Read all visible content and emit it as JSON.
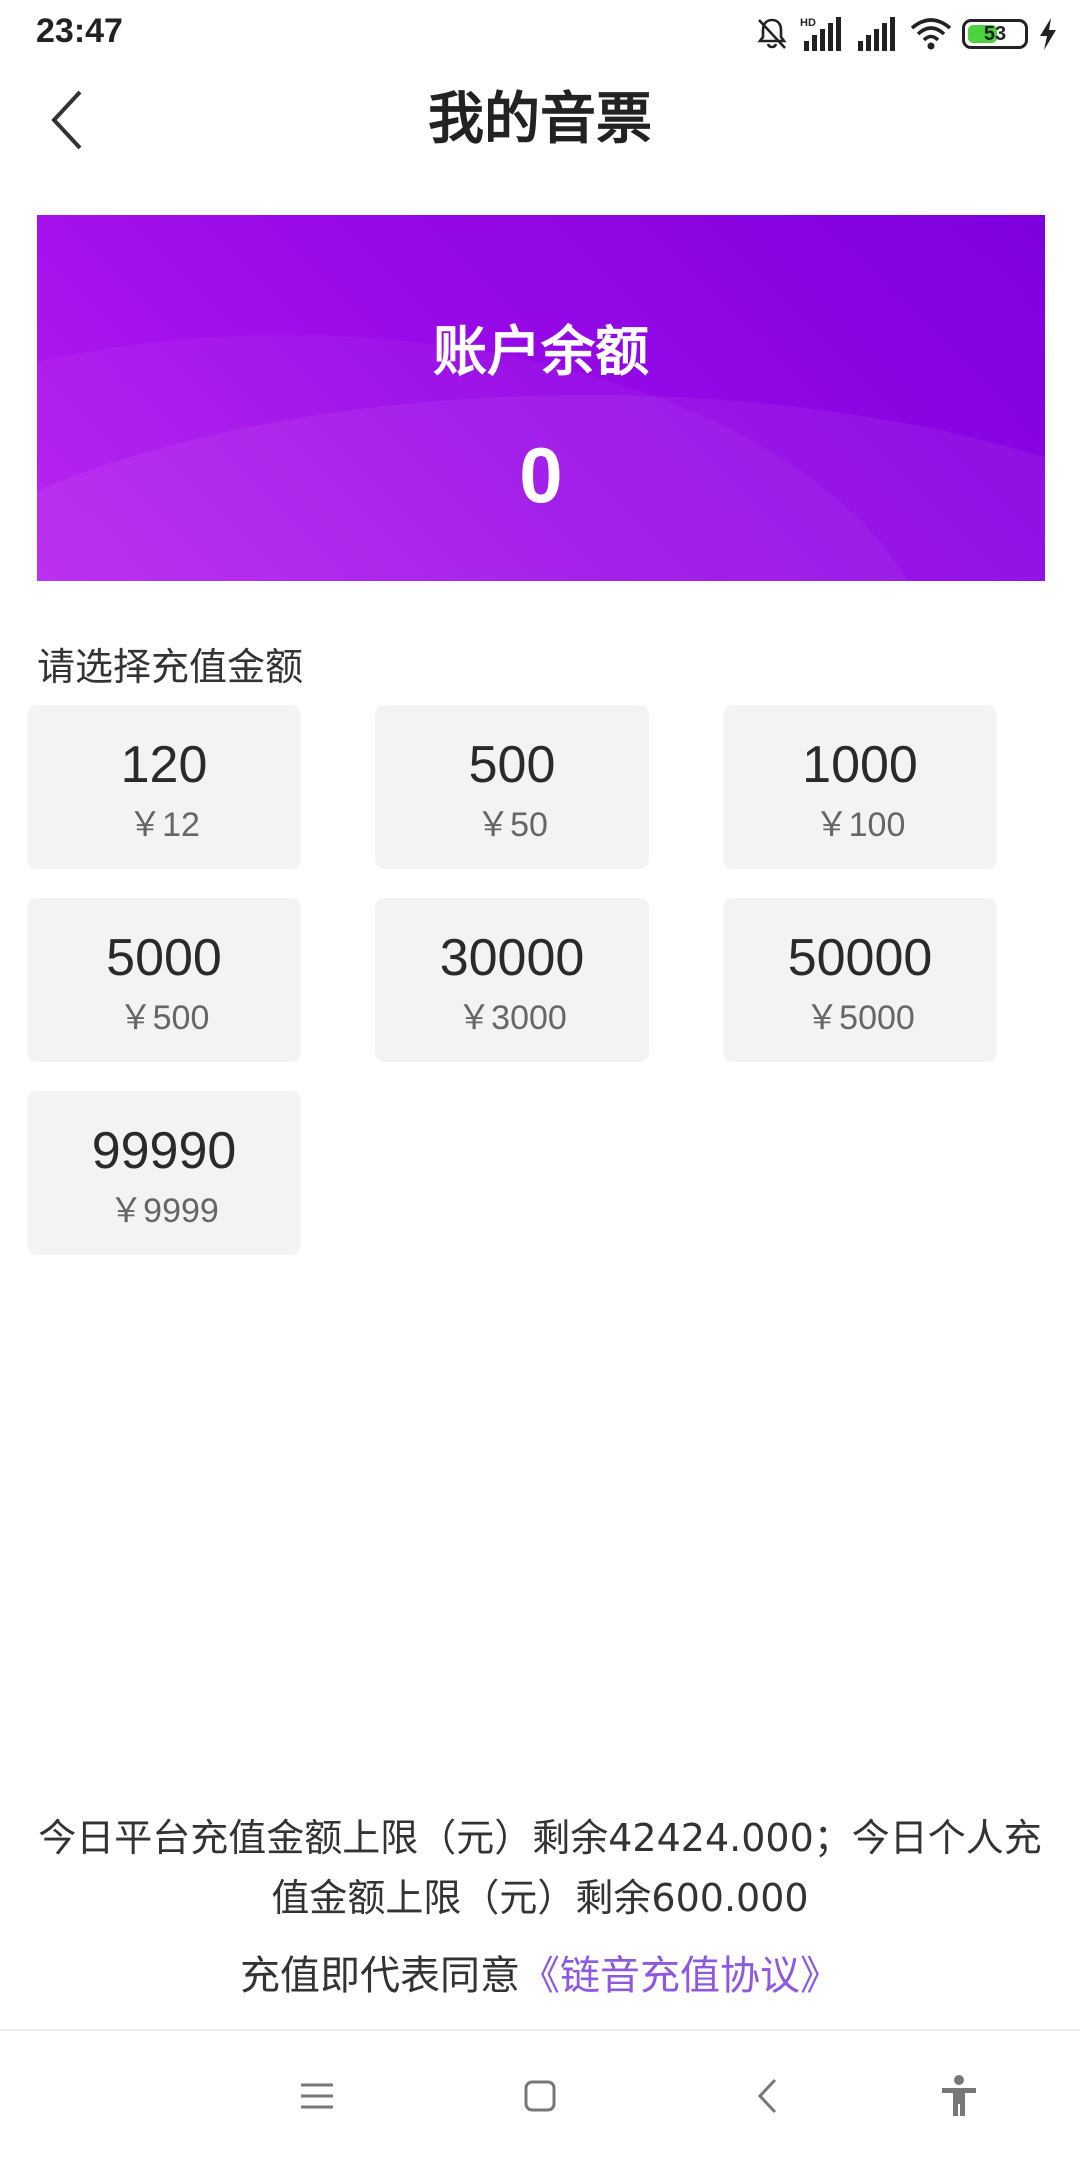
{
  "status_bar": {
    "time": "23:47",
    "battery": "53",
    "battery_level": 0.53,
    "icons": [
      "bell-muted-icon",
      "hd-signal-icon",
      "signal-icon",
      "wifi-icon",
      "battery-icon",
      "charging-icon"
    ]
  },
  "header": {
    "title": "我的音票",
    "back_icon": "chevron-left-icon"
  },
  "balance": {
    "label": "账户余额",
    "value": "0"
  },
  "recharge": {
    "prompt": "请选择充值金额",
    "options": [
      {
        "coins": "120",
        "price": "￥12"
      },
      {
        "coins": "500",
        "price": "￥50"
      },
      {
        "coins": "1000",
        "price": "￥100"
      },
      {
        "coins": "5000",
        "price": "￥500"
      },
      {
        "coins": "30000",
        "price": "￥3000"
      },
      {
        "coins": "50000",
        "price": "￥5000"
      },
      {
        "coins": "99990",
        "price": "￥9999"
      }
    ]
  },
  "footer": {
    "limit_line1": "今日平台充值金额上限（元）剩余42424.000；今日个人充",
    "limit_line2": "值金额上限（元）剩余600.000",
    "agree_text": "充值即代表同意",
    "agree_link": "《链音充值协议》"
  },
  "colors": {
    "card_gradient_start": "#b71cf0",
    "card_gradient_end": "#7e00de",
    "link": "#8e58e0",
    "option_bg": "#f3f3f3"
  },
  "nav": {
    "icons": [
      "menu-icon",
      "home-square-icon",
      "back-chevron-icon",
      "accessibility-icon"
    ]
  }
}
